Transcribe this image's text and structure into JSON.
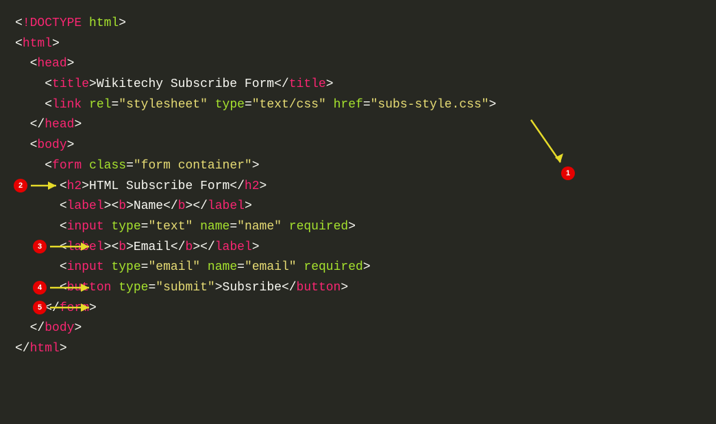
{
  "code": {
    "l1": {
      "p": "",
      "a": "<",
      "b": "!DOCTYPE",
      "c": " html",
      "d": ">"
    },
    "l2": {
      "p": "",
      "a": "<",
      "b": "html",
      "c": ">"
    },
    "l3": {
      "p": "  ",
      "a": "<",
      "b": "head",
      "c": ">"
    },
    "l4": {
      "p": "    ",
      "a": "<",
      "b": "title",
      "c": ">",
      "t": "Wikitechy Subscribe Form",
      "d": "</",
      "e": "title",
      "f": ">"
    },
    "l5": {
      "p": "    ",
      "a": "<",
      "b": "link",
      "sp1": " ",
      "at1": "rel",
      "eq1": "=",
      "v1": "\"stylesheet\"",
      "sp2": " ",
      "at2": "type",
      "eq2": "=",
      "v2": "\"text/css\"",
      "sp3": " ",
      "at3": "href",
      "eq3": "=",
      "v3": "\"subs-style.css\"",
      "c": ">"
    },
    "l6": {
      "p": "  ",
      "a": "</",
      "b": "head",
      "c": ">"
    },
    "l7": {
      "p": "  ",
      "a": "<",
      "b": "body",
      "c": ">"
    },
    "l8": {
      "p": "    ",
      "a": "<",
      "b": "form",
      "sp1": " ",
      "at1": "class",
      "eq1": "=",
      "v1": "\"form container\"",
      "c": ">"
    },
    "l9": {
      "p": "      ",
      "a": "<",
      "b": "h2",
      "c": ">",
      "t": "HTML Subscribe Form",
      "d": "</",
      "e": "h2",
      "f": ">"
    },
    "l10": {
      "p": "      ",
      "a": "<",
      "b": "label",
      "c": ">",
      "d": "<",
      "e": "b",
      "f": ">",
      "t": "Name",
      "g": "</",
      "h": "b",
      "i": ">",
      "j": "</",
      "k": "label",
      "l": ">"
    },
    "l11": {
      "p": "      ",
      "a": "<",
      "b": "input",
      "sp1": " ",
      "at1": "type",
      "eq1": "=",
      "v1": "\"text\"",
      "sp2": " ",
      "at2": "name",
      "eq2": "=",
      "v2": "\"name\"",
      "sp3": " ",
      "at3": "required",
      "c": ">"
    },
    "l12": {
      "p": "      ",
      "a": "<",
      "b": "label",
      "c": ">",
      "d": "<",
      "e": "b",
      "f": ">",
      "t": "Email",
      "g": "</",
      "h": "b",
      "i": ">",
      "j": "</",
      "k": "label",
      "l": ">"
    },
    "l13": {
      "p": "      ",
      "a": "<",
      "b": "input",
      "sp1": " ",
      "at1": "type",
      "eq1": "=",
      "v1": "\"email\"",
      "sp2": " ",
      "at2": "name",
      "eq2": "=",
      "v2": "\"email\"",
      "sp3": " ",
      "at3": "required",
      "c": ">"
    },
    "l14": {
      "p": "      ",
      "a": "<",
      "b": "button",
      "sp1": " ",
      "at1": "type",
      "eq1": "=",
      "v1": "\"submit\"",
      "c": ">",
      "t": "Subsribe",
      "d": "</",
      "e": "button",
      "f": ">"
    },
    "l15": {
      "p": "    ",
      "a": "</",
      "b": "form",
      "c": ">"
    },
    "l16": {
      "p": "  ",
      "a": "</",
      "b": "body",
      "c": ">"
    },
    "l17": {
      "p": "",
      "a": "</",
      "b": "html",
      "c": ">"
    }
  },
  "annotations": {
    "n1": "1",
    "n2": "2",
    "n3": "3",
    "n4": "4",
    "n5": "5"
  }
}
